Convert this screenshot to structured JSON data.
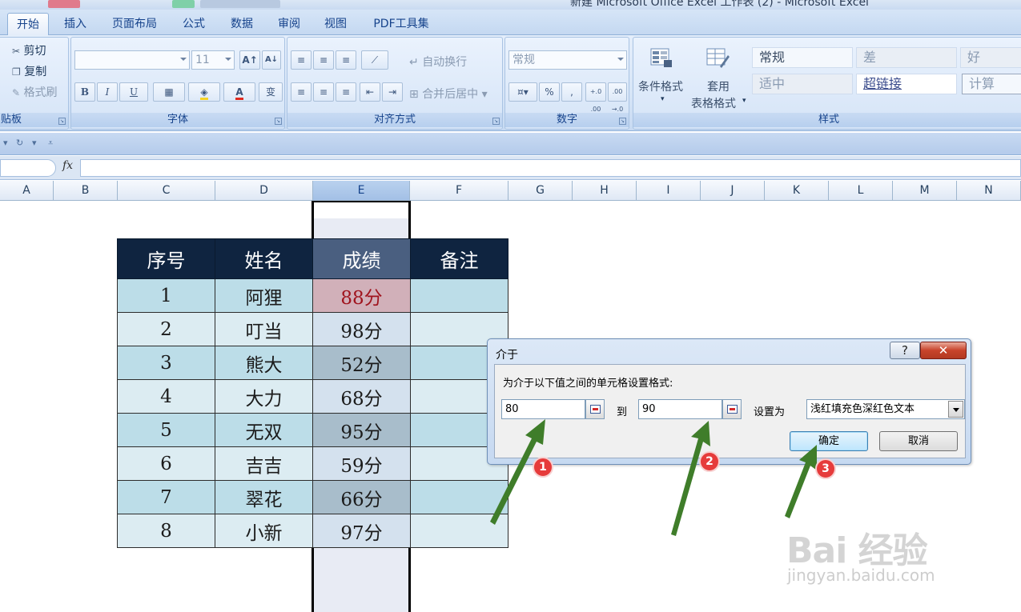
{
  "window": {
    "title": "新建 Microsoft Office Excel 工作表 (2) - Microsoft Excel"
  },
  "ribbon": {
    "tabs": [
      "开始",
      "插入",
      "页面布局",
      "公式",
      "数据",
      "审阅",
      "视图",
      "PDF工具集"
    ],
    "clipboard": {
      "label": "贴板",
      "cut": "剪切",
      "copy": "复制",
      "format_painter": "格式刷"
    },
    "font": {
      "label": "字体",
      "size": "11",
      "bold": "B",
      "italic": "I",
      "underline": "U",
      "wen": "变"
    },
    "alignment": {
      "label": "对齐方式",
      "wrap": "自动换行",
      "merge": "合并后居中"
    },
    "number": {
      "label": "数字",
      "format": "常规",
      "percent": "%",
      "comma": ",",
      "inc_decimal": "+.0 .00",
      "dec_decimal": ".00 →.0"
    },
    "styles": {
      "label": "样式",
      "conditional": "条件格式",
      "table_format_line1": "套用",
      "table_format_line2": "表格格式",
      "cells": [
        "常规",
        "差",
        "好",
        "适中",
        "超链接",
        "计算"
      ]
    }
  },
  "formula_bar": {
    "fx": "fx"
  },
  "columns": [
    "A",
    "B",
    "C",
    "D",
    "E",
    "F",
    "G",
    "H",
    "I",
    "J",
    "K",
    "L",
    "M",
    "N"
  ],
  "table": {
    "headers": [
      "序号",
      "姓名",
      "成绩",
      "备注"
    ],
    "rows": [
      {
        "no": "1",
        "name": "阿狸",
        "score": "88分",
        "note": ""
      },
      {
        "no": "2",
        "name": "叮当",
        "score": "98分",
        "note": ""
      },
      {
        "no": "3",
        "name": "熊大",
        "score": "52分",
        "note": ""
      },
      {
        "no": "4",
        "name": "大力",
        "score": "68分",
        "note": ""
      },
      {
        "no": "5",
        "name": "无双",
        "score": "95分",
        "note": ""
      },
      {
        "no": "6",
        "name": "吉吉",
        "score": "59分",
        "note": ""
      },
      {
        "no": "7",
        "name": "翠花",
        "score": "66分",
        "note": ""
      },
      {
        "no": "8",
        "name": "小新",
        "score": "97分",
        "note": ""
      }
    ]
  },
  "dialog": {
    "title": "介于",
    "help": "?",
    "close": "✕",
    "prompt": "为介于以下值之间的单元格设置格式:",
    "from_value": "80",
    "to_label": "到",
    "to_value": "90",
    "set_as_label": "设置为",
    "set_as_value": "浅红填充色深红色文本",
    "ok": "确定",
    "cancel": "取消"
  },
  "annotations": {
    "badges": [
      "1",
      "2",
      "3"
    ],
    "arrow_color": "#3f7d2a",
    "badge_color": "#e63b3b"
  },
  "watermark": {
    "logo": "Bai 经验",
    "url": "jingyan.baidu.com"
  }
}
